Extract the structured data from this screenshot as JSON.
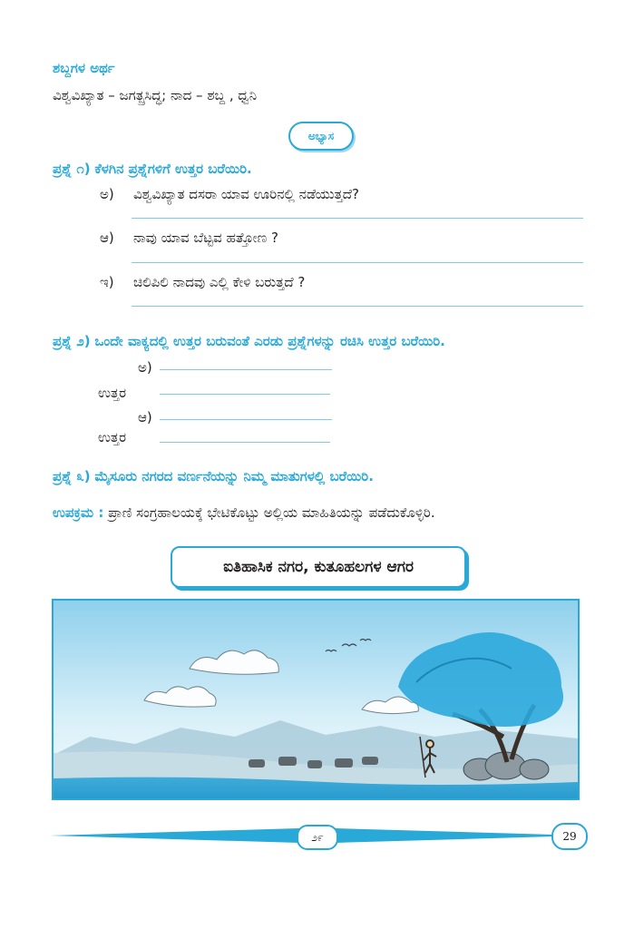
{
  "glossary": {
    "heading": "ಶಬ್ದಗಳ ಅರ್ಥ",
    "text": "ವಿಶ್ವವಿಖ್ಯಾತ – ಜಗತ್ಪ್ರಸಿದ್ಧ; ನಾದ – ಶಬ್ದ , ಧ್ವನಿ"
  },
  "badge": "ಅಭ್ಯಾಸ",
  "q1": {
    "label": "ಪ್ರಶ್ನೆ ೧)",
    "text": "ಕೆಳಗಿನ ಪ್ರಶ್ನೆಗಳಿಗೆ ಉತ್ತರ ಬರೆಯಿರಿ.",
    "items": [
      {
        "marker": "ಅ)",
        "text": "ವಿಶ್ವವಿಖ್ಯಾತ ದಸರಾ ಯಾವ ಊರಿನಲ್ಲಿ ನಡೆಯುತ್ತದೆ?"
      },
      {
        "marker": "ಆ)",
        "text": "ನಾವು ಯಾವ ಬೆಟ್ಟವ ಹತ್ತೋಣ ?"
      },
      {
        "marker": "ಇ)",
        "text": "ಚಿಲಿಪಿಲಿ ನಾದವು ಎಲ್ಲಿ ಕೇಳಿ ಬರುತ್ತದೆ ?"
      }
    ]
  },
  "q2": {
    "label": "ಪ್ರಶ್ನೆ ೨)",
    "text": "ಒಂದೇ ವಾಕ್ಯದಲ್ಲಿ ಉತ್ತರ ಬರುವಂತೆ ಎರಡು ಪ್ರಶ್ನೆಗಳನ್ನು ರಚಿಸಿ ಉತ್ತರ ಬರೆಯಿರಿ.",
    "markers": [
      "ಅ)",
      "ಆ)"
    ],
    "answer_label": "ಉತ್ತರ"
  },
  "q3": {
    "label": "ಪ್ರಶ್ನೆ ೩)",
    "text": "ಮೈಸೂರು ನಗರದ ವರ್ಣನೆಯನ್ನು ನಿಮ್ಮ ಮಾತುಗಳಲ್ಲಿ ಬರೆಯಿರಿ."
  },
  "activity": {
    "label": "ಉಪಕ್ರಮ :",
    "text": "ಪ್ರಾಣಿ ಸಂಗ್ರಹಾಲಯಕ್ಕೆ ಭೇಟಿಕೊಟ್ಟು ಅಲ್ಲಿಯ ಮಾಹಿತಿಯನ್ನು ಪಡೆದುಕೊಳ್ಳಿರಿ."
  },
  "lesson_title": "ಐತಿಹಾಸಿಕ ನಗರ, ಕುತೂಹಲಗಳ ಆಗರ",
  "page_number_local": "೨೯",
  "page_number": "29",
  "colors": {
    "accent": "#29a9d8",
    "rule": "#7ecbe8",
    "text": "#231f20"
  },
  "illustration": "landscape-with-tree-cattle-hills"
}
